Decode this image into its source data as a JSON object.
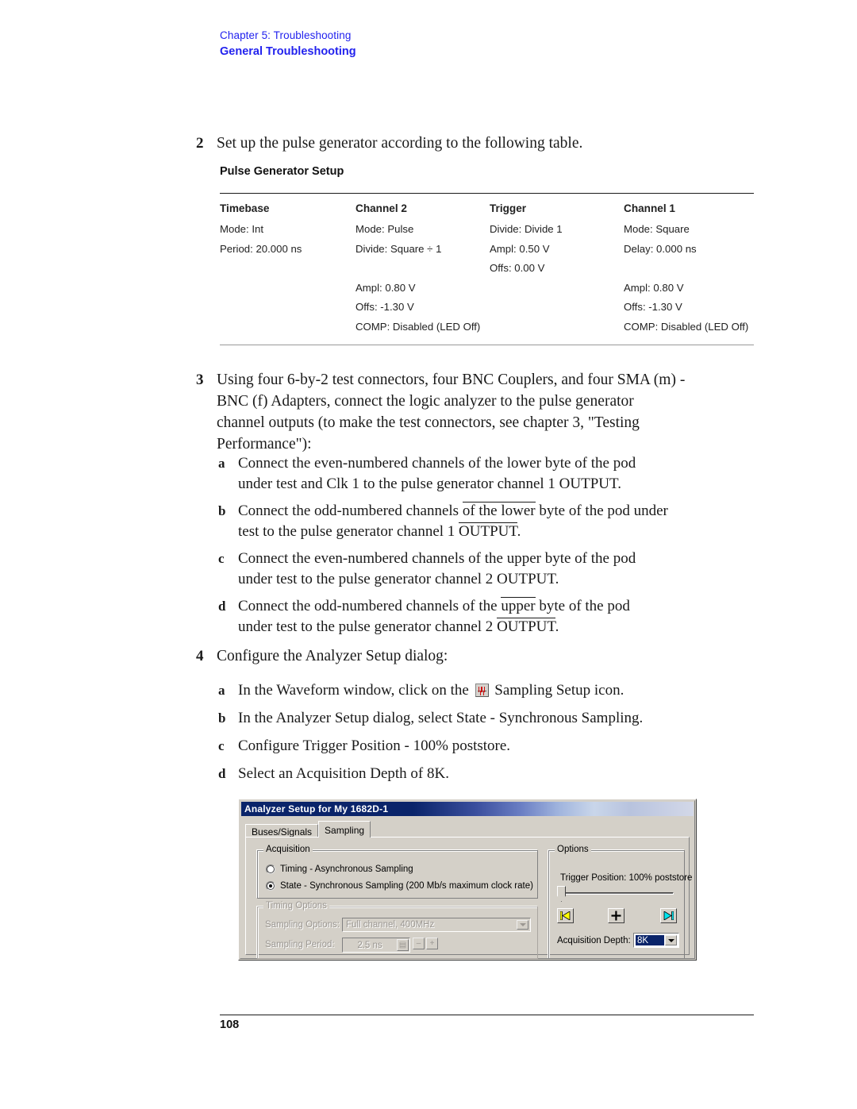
{
  "header": {
    "chapter": "Chapter 5: Troubleshooting",
    "section": "General Troubleshooting",
    "color": "#2222ee"
  },
  "footer": {
    "page_number": "108"
  },
  "step2": {
    "number": "2",
    "text": "Set up the pulse generator according to the following table.",
    "table": {
      "caption": "Pulse Generator Setup",
      "columns": [
        "Timebase",
        "Channel 2",
        "Trigger",
        "Channel 1"
      ],
      "cells": {
        "timebase": [
          "Mode: Int",
          "Period: 20.000 ns"
        ],
        "channel2": [
          "Mode: Pulse",
          "Divide: Square ÷ 1",
          "",
          "Ampl: 0.80 V",
          "Offs: -1.30 V",
          "COMP: Disabled (LED Off)"
        ],
        "trigger": [
          "Divide: Divide 1",
          "Ampl: 0.50 V",
          "Offs: 0.00 V"
        ],
        "channel1": [
          "Mode: Square",
          "Delay: 0.000 ns",
          "",
          "Ampl: 0.80 V",
          "Offs: -1.30 V",
          "COMP: Disabled (LED Off)"
        ]
      }
    }
  },
  "step3": {
    "number": "3",
    "line1": "Using four 6-by-2 test connectors, four BNC Couplers, and four SMA (m) -",
    "line2": "BNC (f) Adapters, connect the logic analyzer to the pulse generator",
    "line3": "channel outputs (to make the test connectors, see chapter 3, \"Testing",
    "line4": "Performance\"):",
    "items": [
      {
        "letter": "a",
        "l1a": "Connect the even-numbered channels of the lower byte of the pod",
        "l2a": "under test and Clk 1 to the pulse generator channel 1 OUTPUT."
      },
      {
        "letter": "b",
        "l1a": "Connect the odd-numbered channels ",
        "l1b": "of the lower",
        "l1c": " byte of the pod under",
        "l2a": "test to the pulse generator channel 1 ",
        "l2b": "OUTPUT",
        "l2c": "."
      },
      {
        "letter": "c",
        "l1a": "Connect the even-numbered channels of the upper byte of the pod",
        "l2a": "under test to the pulse generator channel 2 OUTPUT."
      },
      {
        "letter": "d",
        "l1a": "Connect the odd-numbered channels of the ",
        "l1b": "upper",
        "l1c": " byte of the pod",
        "l2a": "under test to the pulse generator channel 2 ",
        "l2b": "OUTPUT",
        "l2c": "."
      }
    ]
  },
  "step4": {
    "number": "4",
    "text": "Configure the Analyzer Setup dialog:",
    "items": [
      {
        "letter": "a",
        "before": "In the Waveform window, click on the ",
        "icon": "sampling-setup-icon",
        "after": " Sampling Setup icon."
      },
      {
        "letter": "b",
        "before": "In the Analyzer Setup dialog, select State - Synchronous Sampling.",
        "after": ""
      },
      {
        "letter": "c",
        "before": "Configure Trigger Position - 100% poststore.",
        "after": ""
      },
      {
        "letter": "d",
        "before": "Select an Acquisition Depth of 8K.",
        "after": ""
      }
    ]
  },
  "dialog": {
    "title": "Analyzer Setup for My 1682D-1",
    "tabs": [
      {
        "label": "Buses/Signals",
        "active": false
      },
      {
        "label": "Sampling",
        "active": true
      }
    ],
    "acquisition": {
      "group_label": "Acquisition",
      "options": [
        {
          "label": "Timing - Asynchronous Sampling",
          "selected": false
        },
        {
          "label": "State - Synchronous Sampling (200 Mb/s maximum clock rate)",
          "selected": true
        }
      ]
    },
    "timing_options": {
      "group_label": "Timing Options",
      "enabled": false,
      "sampling_options_label": "Sampling Options:",
      "sampling_options_value": "Full channel, 400MHz",
      "sampling_period_label": "Sampling Period:",
      "sampling_period_value": "2.5 ns",
      "spin_minus": "–",
      "spin_plus": "+"
    },
    "options": {
      "group_label": "Options",
      "trigger_position": "Trigger Position: 100% poststore",
      "slider_value_percent": 0,
      "buttons": [
        {
          "name": "go-to-start-button",
          "color": "#ffff00"
        },
        {
          "name": "add-marker-button",
          "label": "+"
        },
        {
          "name": "go-to-end-button",
          "color": "#00e5ee"
        }
      ],
      "acquisition_depth_label": "Acquisition Depth:",
      "acquisition_depth_value": "8K",
      "selection_color": "#0a246a"
    }
  }
}
